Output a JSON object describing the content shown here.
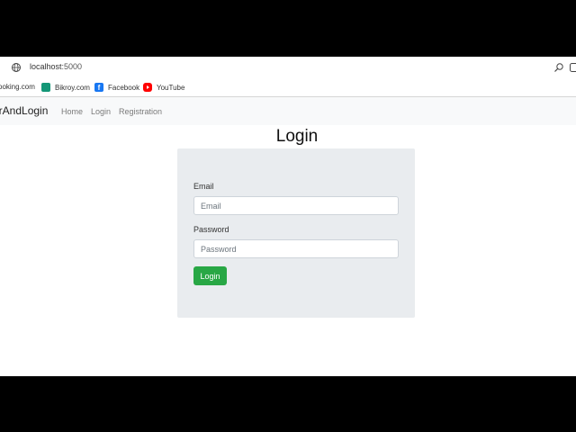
{
  "browser": {
    "url_host": "localhost",
    "url_port": ":5000",
    "bookmarks": [
      {
        "label": "ooking.com",
        "icon": "booking-icon",
        "color": "#ffffff"
      },
      {
        "label": "Bikroy.com",
        "icon": "bikroy-icon",
        "color": "#149777"
      },
      {
        "label": "Facebook",
        "icon": "facebook-icon",
        "color": "#1877f2"
      },
      {
        "label": "YouTube",
        "icon": "youtube-icon",
        "color": "#ff0000"
      }
    ]
  },
  "navbar": {
    "brand": "erAndLogin",
    "links": [
      "Home",
      "Login",
      "Registration"
    ]
  },
  "page": {
    "title": "Login",
    "email_label": "Email",
    "email_placeholder": "Email",
    "password_label": "Password",
    "password_placeholder": "Password",
    "login_button": "Login",
    "button_color": "#28a745"
  }
}
